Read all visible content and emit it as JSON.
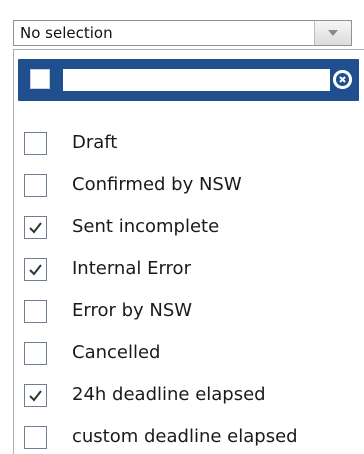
{
  "select": {
    "value": "No selection",
    "arrow_icon": "chevron-down-icon"
  },
  "filter": {
    "select_all_checked": false,
    "search_value": "",
    "clear_icon": "clear-circle-icon"
  },
  "options": [
    {
      "label": "Draft",
      "checked": false
    },
    {
      "label": "Confirmed by NSW",
      "checked": false
    },
    {
      "label": "Sent incomplete",
      "checked": true
    },
    {
      "label": "Internal Error",
      "checked": true
    },
    {
      "label": "Error by NSW",
      "checked": false
    },
    {
      "label": "Cancelled",
      "checked": false
    },
    {
      "label": "24h deadline elapsed",
      "checked": true
    },
    {
      "label": "custom deadline elapsed",
      "checked": false
    }
  ],
  "colors": {
    "header_bar": "#1f4f8f",
    "checkbox_border": "#6f7f93"
  }
}
